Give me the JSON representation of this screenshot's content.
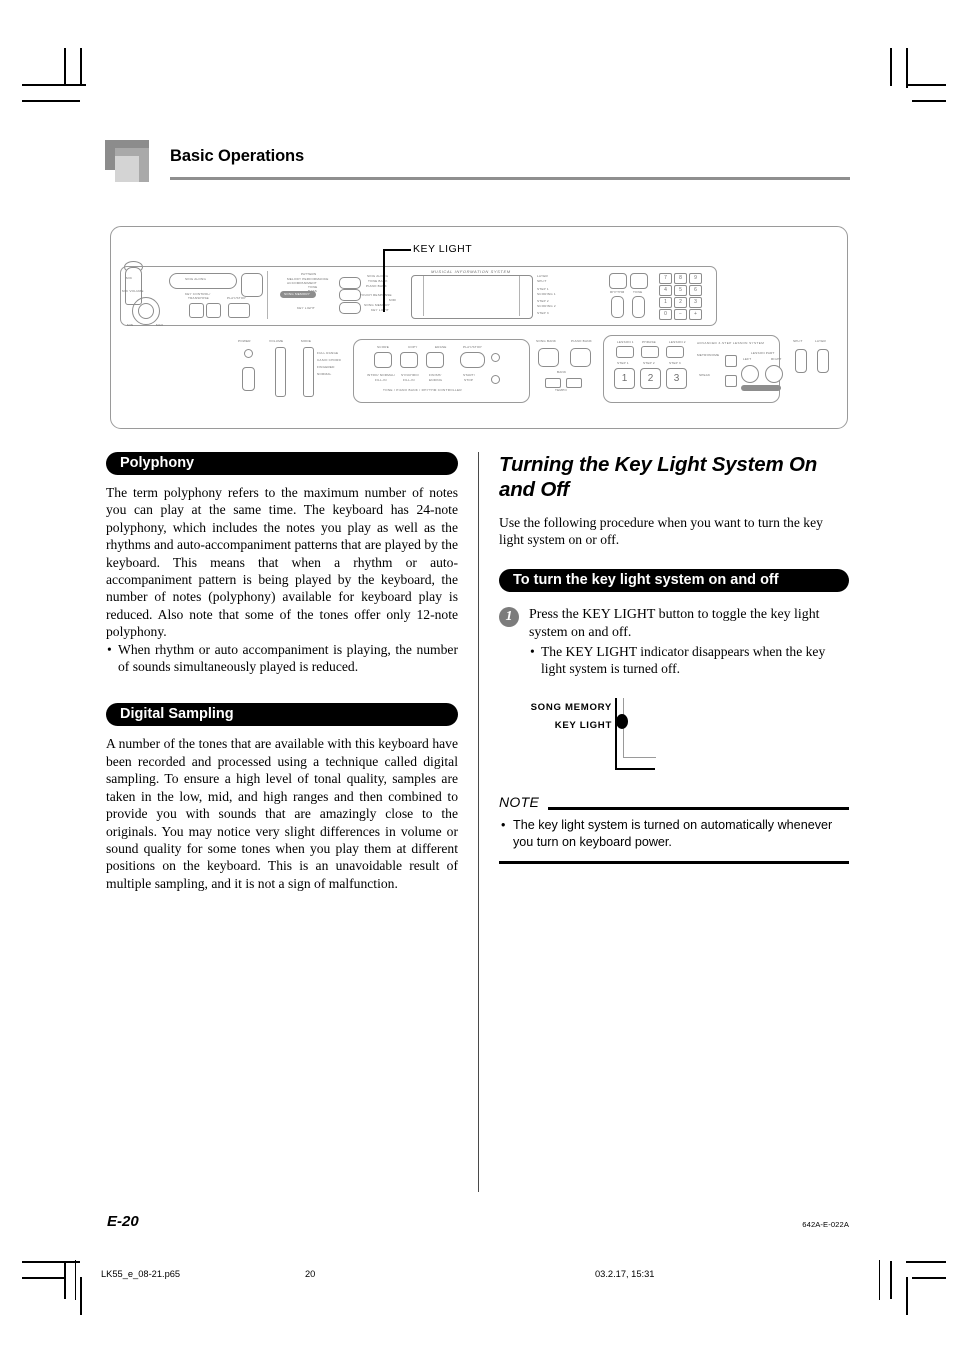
{
  "header": {
    "title": "Basic Operations"
  },
  "illustration": {
    "callout_label": "KEY LIGHT",
    "panel_labels": {
      "mic": "MIC",
      "mic_volume": "MIC VOLUME",
      "mic_min": "MIN",
      "mic_max": "MAX",
      "sing_along": "SING ALONG",
      "key_control_transpose": "KEY CONTROL/\nTRANSPOSE",
      "play_stop": "PLAY/STOP",
      "pattern": "PATTERN",
      "pattern_sub": "MELODY PERFORMANCE\nACCOMPANIMENT",
      "pattern_tone": "TONE",
      "pattern_bass": "BASS",
      "song_memory": "SONG MEMORY",
      "key_light": "KEY LIGHT",
      "mis_title": "MUSICAL INFORMATION SYSTEM",
      "left_readouts": [
        "SING ALONG",
        "TONE BANK",
        "PIANO BANK",
        "TOUCH RESPONSE",
        "MIDI",
        "SONG MEMORY",
        "KEY LIGHT"
      ],
      "right_readouts": [
        "LAYER",
        "SPLIT",
        "STEP 1",
        "SCORING 1",
        "STEP 2",
        "SCORING 2",
        "STEP 3"
      ],
      "rhythm": "RHYTHM",
      "tone": "TONE",
      "numpad": [
        "7",
        "8",
        "9",
        "4",
        "5",
        "6",
        "1",
        "2",
        "3",
        "0",
        "-",
        "+"
      ],
      "power": "POWER",
      "volume": "VOLUME",
      "mode": "MODE",
      "mode_options": [
        "FULL RANGE",
        "CASIO CHORD",
        "FINGERED",
        "NORMAL"
      ],
      "controller_title": "TONE / PIANO BANK / RHYTHM CONTROLLER",
      "controller_buttons": [
        "SCORE",
        "COPY",
        "ERASE",
        "PLAY/STOP"
      ],
      "controller_sub": [
        "INTRO/ NORMAL/ FILL-IN",
        "SYNCHRO/ FILL-IN",
        "FINISH/ ENDING",
        "START/ STOP"
      ],
      "song_bank": "SONG BANK",
      "piano_bank": "PIANO BANK",
      "tempo": "TEMPO",
      "lesson_group": [
        "LESSON 1",
        "PHRASE",
        "LESSON 2"
      ],
      "step_buttons": [
        "1",
        "2",
        "3"
      ],
      "step_labels": [
        "STEP 1",
        "STEP 2",
        "STEP 3"
      ],
      "advanced_title": "ADVANCED 3-STEP LESSON SYSTEM",
      "metronome": "METRONOME",
      "speak": "SPEAK",
      "lesson_part": "LESSON PART",
      "lesson_left": "LEFT",
      "lesson_right": "RIGHT",
      "voice_fingering": "VOICE  FINGERING",
      "split": "SPLIT",
      "layer": "LAYER"
    }
  },
  "left_column": {
    "polyphony": {
      "heading": "Polyphony",
      "paragraph": "The term polyphony refers to the maximum number of notes you can play at the same time. The keyboard has 24-note polyphony, which includes the notes you play as well as the rhythms and auto-accompaniment patterns that are played by the keyboard. This means that when a rhythm or auto-accompaniment pattern is being played by the keyboard, the number of notes (polyphony) available for keyboard play is reduced. Also note that some of the tones offer only 12-note polyphony.",
      "bullets": [
        "When rhythm or auto accompaniment is playing, the number of sounds simultaneously played is reduced."
      ]
    },
    "digital_sampling": {
      "heading": "Digital Sampling",
      "paragraph": "A number of the tones that are available with this keyboard have been recorded and processed using a technique called digital sampling. To ensure a high level of tonal quality, samples are taken in the low, mid, and high ranges and then combined to provide you with sounds that are amazingly close to the originals. You may notice very slight differences in volume or sound quality for some tones when you play them at different positions on the keyboard. This is an unavoidable result of multiple sampling, and it is not a sign of malfunction."
    }
  },
  "right_column": {
    "section_title": "Turning the Key Light System On and Off",
    "intro": "Use the following procedure when you want to turn the key light system on or off.",
    "procedure_heading": "To turn the key light system on and off",
    "step": {
      "number": "1",
      "text": "Press the KEY LIGHT button to toggle the key light system on and off.",
      "bullets": [
        "The KEY LIGHT indicator disappears when the key light system is turned off."
      ]
    },
    "indicator_figure": {
      "label_song_memory": "SONG MEMORY",
      "label_key_light": "KEY LIGHT"
    },
    "note": {
      "title": "NOTE",
      "text": "The key light system is turned on automatically whenever you turn on keyboard power."
    }
  },
  "footer": {
    "page_number": "E-20",
    "doc_code": "642A-E-022A",
    "print_file": "LK55_e_08-21.p65",
    "print_page": "20",
    "print_timestamp": "03.2.17, 15:31"
  }
}
